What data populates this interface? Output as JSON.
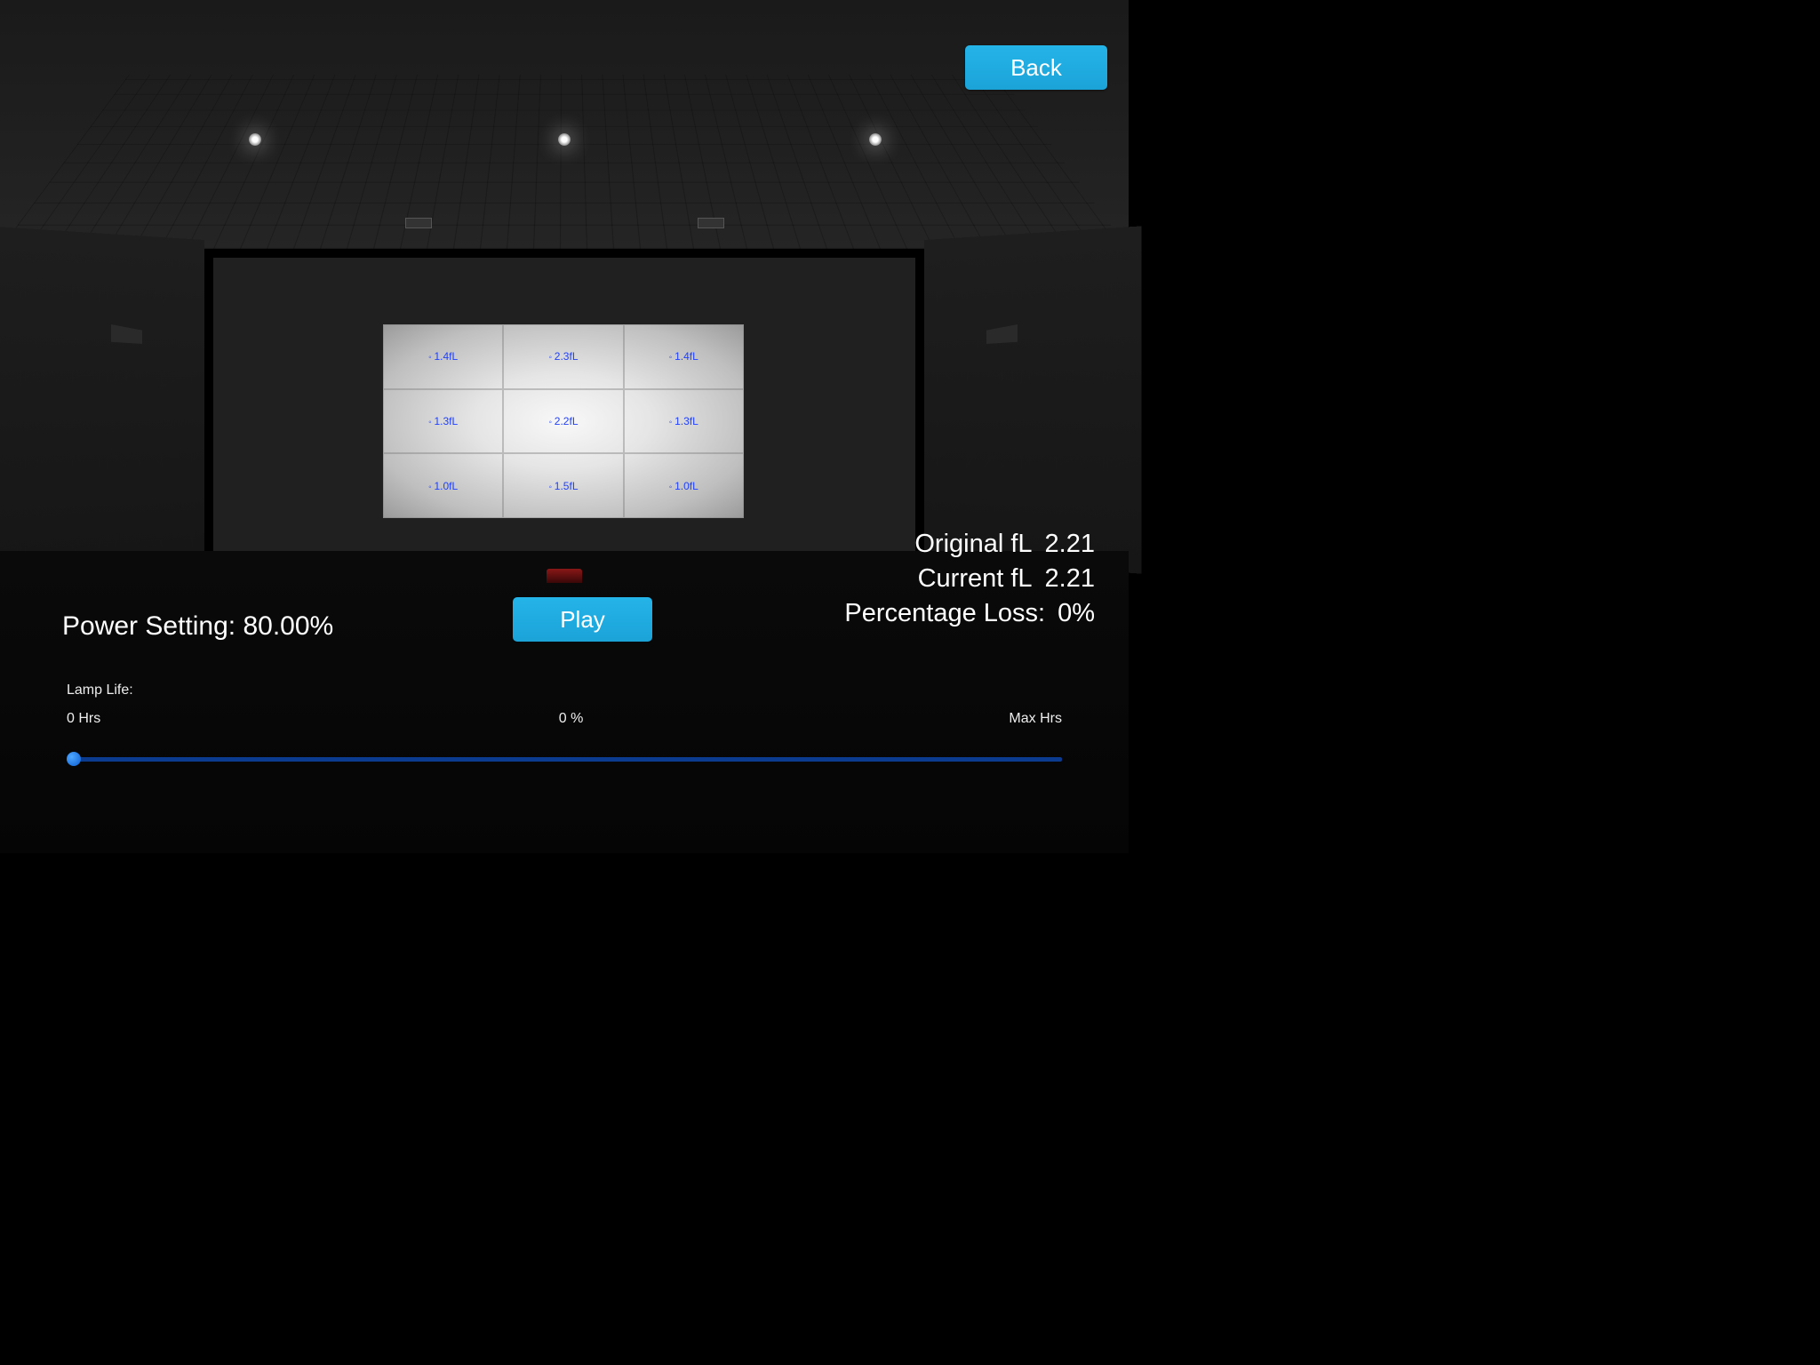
{
  "buttons": {
    "back": "Back",
    "play": "Play"
  },
  "power": {
    "label": "Power Setting:",
    "value": "80.00%"
  },
  "stats": {
    "original_label": "Original fL",
    "original_value": "2.21",
    "current_label": "Current fL",
    "current_value": "2.21",
    "loss_label": "Percentage Loss:",
    "loss_value": "0%"
  },
  "lamp": {
    "label": "Lamp Life:",
    "min": "0 Hrs",
    "mid": "0 %",
    "max": "Max Hrs"
  },
  "screen_grid": {
    "r0c0": "1.4fL",
    "r0c1": "2.3fL",
    "r0c2": "1.4fL",
    "r1c0": "1.3fL",
    "r1c1": "2.2fL",
    "r1c2": "1.3fL",
    "r2c0": "1.0fL",
    "r2c1": "1.5fL",
    "r2c2": "1.0fL"
  }
}
